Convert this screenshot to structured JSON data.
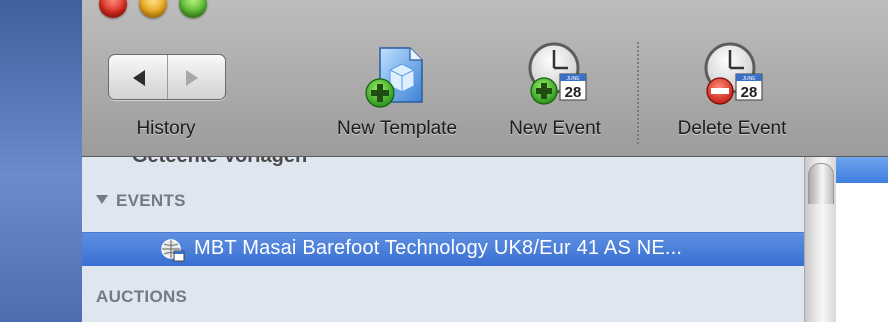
{
  "toolbar": {
    "history_label": "History",
    "new_template_label": "New Template",
    "new_event_label": "New Event",
    "delete_event_label": "Delete Event",
    "calendar_day": "28",
    "calendar_month": "JUNE"
  },
  "sidebar": {
    "partial_row": "Geteente Vorlagen",
    "events_header": "EVENTS",
    "selected_event": "MBT Masai Barefoot Technology UK8/Eur 41 AS NE...",
    "auctions_header": "AUCTIONS"
  },
  "colors": {
    "selection": "#3a6fd3",
    "toolbar": "#a9a9a9",
    "sidebar_bg": "#dfe6ef",
    "section_text": "#6f7b8b"
  }
}
